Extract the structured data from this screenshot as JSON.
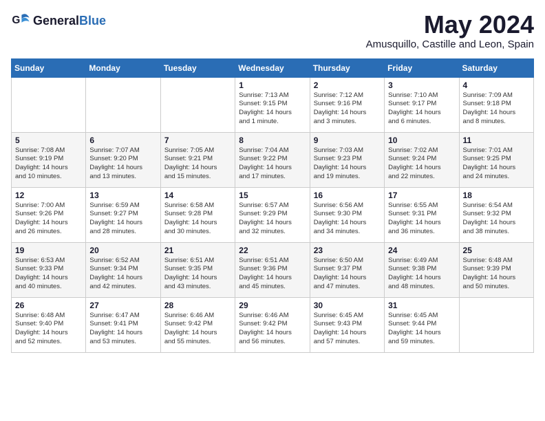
{
  "header": {
    "logo_general": "General",
    "logo_blue": "Blue",
    "month": "May 2024",
    "location": "Amusquillo, Castille and Leon, Spain"
  },
  "weekdays": [
    "Sunday",
    "Monday",
    "Tuesday",
    "Wednesday",
    "Thursday",
    "Friday",
    "Saturday"
  ],
  "weeks": [
    [
      {
        "day": "",
        "content": ""
      },
      {
        "day": "",
        "content": ""
      },
      {
        "day": "",
        "content": ""
      },
      {
        "day": "1",
        "content": "Sunrise: 7:13 AM\nSunset: 9:15 PM\nDaylight: 14 hours\nand 1 minute."
      },
      {
        "day": "2",
        "content": "Sunrise: 7:12 AM\nSunset: 9:16 PM\nDaylight: 14 hours\nand 3 minutes."
      },
      {
        "day": "3",
        "content": "Sunrise: 7:10 AM\nSunset: 9:17 PM\nDaylight: 14 hours\nand 6 minutes."
      },
      {
        "day": "4",
        "content": "Sunrise: 7:09 AM\nSunset: 9:18 PM\nDaylight: 14 hours\nand 8 minutes."
      }
    ],
    [
      {
        "day": "5",
        "content": "Sunrise: 7:08 AM\nSunset: 9:19 PM\nDaylight: 14 hours\nand 10 minutes."
      },
      {
        "day": "6",
        "content": "Sunrise: 7:07 AM\nSunset: 9:20 PM\nDaylight: 14 hours\nand 13 minutes."
      },
      {
        "day": "7",
        "content": "Sunrise: 7:05 AM\nSunset: 9:21 PM\nDaylight: 14 hours\nand 15 minutes."
      },
      {
        "day": "8",
        "content": "Sunrise: 7:04 AM\nSunset: 9:22 PM\nDaylight: 14 hours\nand 17 minutes."
      },
      {
        "day": "9",
        "content": "Sunrise: 7:03 AM\nSunset: 9:23 PM\nDaylight: 14 hours\nand 19 minutes."
      },
      {
        "day": "10",
        "content": "Sunrise: 7:02 AM\nSunset: 9:24 PM\nDaylight: 14 hours\nand 22 minutes."
      },
      {
        "day": "11",
        "content": "Sunrise: 7:01 AM\nSunset: 9:25 PM\nDaylight: 14 hours\nand 24 minutes."
      }
    ],
    [
      {
        "day": "12",
        "content": "Sunrise: 7:00 AM\nSunset: 9:26 PM\nDaylight: 14 hours\nand 26 minutes."
      },
      {
        "day": "13",
        "content": "Sunrise: 6:59 AM\nSunset: 9:27 PM\nDaylight: 14 hours\nand 28 minutes."
      },
      {
        "day": "14",
        "content": "Sunrise: 6:58 AM\nSunset: 9:28 PM\nDaylight: 14 hours\nand 30 minutes."
      },
      {
        "day": "15",
        "content": "Sunrise: 6:57 AM\nSunset: 9:29 PM\nDaylight: 14 hours\nand 32 minutes."
      },
      {
        "day": "16",
        "content": "Sunrise: 6:56 AM\nSunset: 9:30 PM\nDaylight: 14 hours\nand 34 minutes."
      },
      {
        "day": "17",
        "content": "Sunrise: 6:55 AM\nSunset: 9:31 PM\nDaylight: 14 hours\nand 36 minutes."
      },
      {
        "day": "18",
        "content": "Sunrise: 6:54 AM\nSunset: 9:32 PM\nDaylight: 14 hours\nand 38 minutes."
      }
    ],
    [
      {
        "day": "19",
        "content": "Sunrise: 6:53 AM\nSunset: 9:33 PM\nDaylight: 14 hours\nand 40 minutes."
      },
      {
        "day": "20",
        "content": "Sunrise: 6:52 AM\nSunset: 9:34 PM\nDaylight: 14 hours\nand 42 minutes."
      },
      {
        "day": "21",
        "content": "Sunrise: 6:51 AM\nSunset: 9:35 PM\nDaylight: 14 hours\nand 43 minutes."
      },
      {
        "day": "22",
        "content": "Sunrise: 6:51 AM\nSunset: 9:36 PM\nDaylight: 14 hours\nand 45 minutes."
      },
      {
        "day": "23",
        "content": "Sunrise: 6:50 AM\nSunset: 9:37 PM\nDaylight: 14 hours\nand 47 minutes."
      },
      {
        "day": "24",
        "content": "Sunrise: 6:49 AM\nSunset: 9:38 PM\nDaylight: 14 hours\nand 48 minutes."
      },
      {
        "day": "25",
        "content": "Sunrise: 6:48 AM\nSunset: 9:39 PM\nDaylight: 14 hours\nand 50 minutes."
      }
    ],
    [
      {
        "day": "26",
        "content": "Sunrise: 6:48 AM\nSunset: 9:40 PM\nDaylight: 14 hours\nand 52 minutes."
      },
      {
        "day": "27",
        "content": "Sunrise: 6:47 AM\nSunset: 9:41 PM\nDaylight: 14 hours\nand 53 minutes."
      },
      {
        "day": "28",
        "content": "Sunrise: 6:46 AM\nSunset: 9:42 PM\nDaylight: 14 hours\nand 55 minutes."
      },
      {
        "day": "29",
        "content": "Sunrise: 6:46 AM\nSunset: 9:42 PM\nDaylight: 14 hours\nand 56 minutes."
      },
      {
        "day": "30",
        "content": "Sunrise: 6:45 AM\nSunset: 9:43 PM\nDaylight: 14 hours\nand 57 minutes."
      },
      {
        "day": "31",
        "content": "Sunrise: 6:45 AM\nSunset: 9:44 PM\nDaylight: 14 hours\nand 59 minutes."
      },
      {
        "day": "",
        "content": ""
      }
    ]
  ]
}
